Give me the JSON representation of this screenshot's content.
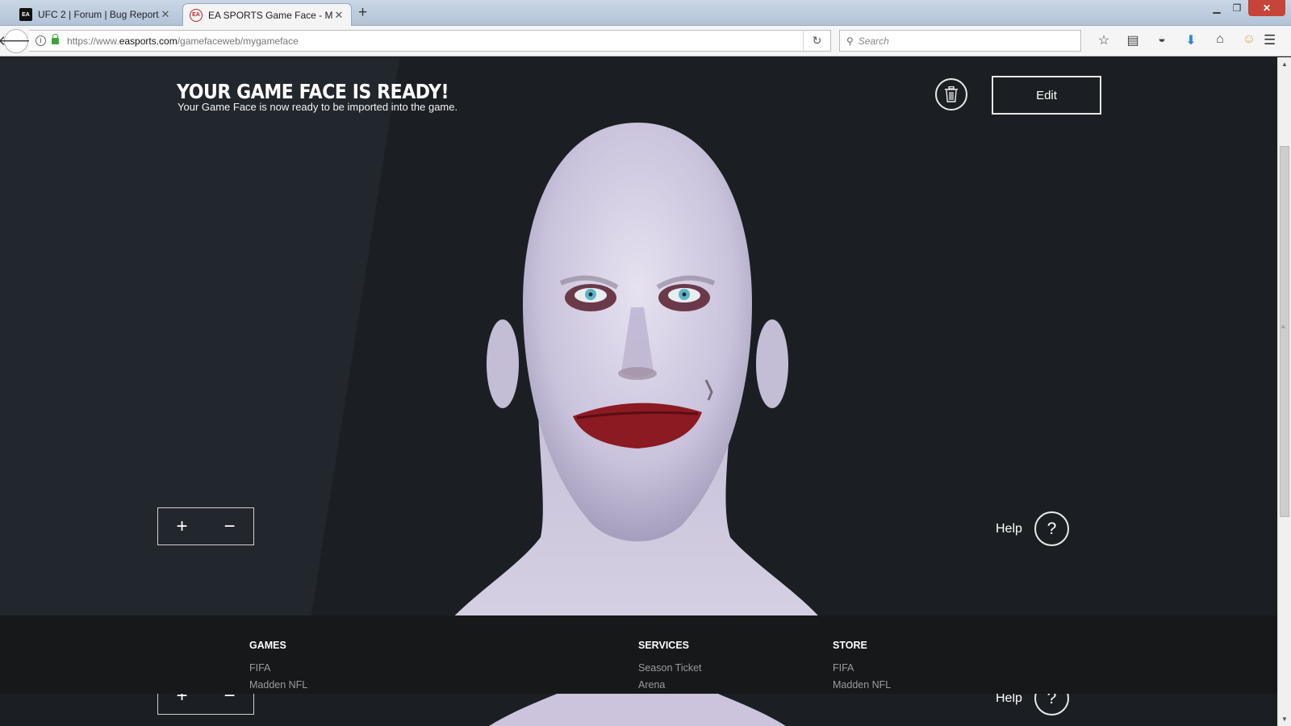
{
  "browser": {
    "tabs": [
      {
        "favicon": "EA",
        "title": "UFC 2 | Forum | Bug Report...",
        "close": "✕"
      },
      {
        "favicon": "EA",
        "title": "EA SPORTS Game Face - M...",
        "close": "✕"
      }
    ],
    "new_tab": "+",
    "url_prefix": "https://www.",
    "url_host": "easports.com",
    "url_path": "/gamefaceweb/mygameface",
    "search_placeholder": "Search",
    "toolbar_icons": [
      "star-icon",
      "reading-list-icon",
      "pocket-icon",
      "download-icon",
      "home-icon",
      "sync-icon",
      "menu-icon"
    ]
  },
  "page": {
    "title": "YOUR GAME FACE IS READY!",
    "subtitle": "Your Game Face is now ready to be imported into the game.",
    "edit_label": "Edit",
    "zoom_in": "+",
    "zoom_out": "−",
    "help_label": "Help",
    "help_icon": "?"
  },
  "footer": {
    "games": {
      "heading": "GAMES",
      "links": [
        "FIFA",
        "Madden NFL"
      ]
    },
    "services": {
      "heading": "SERVICES",
      "links": [
        "Season Ticket",
        "Arena"
      ]
    },
    "store": {
      "heading": "STORE",
      "links": [
        "FIFA",
        "Madden NFL"
      ]
    }
  }
}
